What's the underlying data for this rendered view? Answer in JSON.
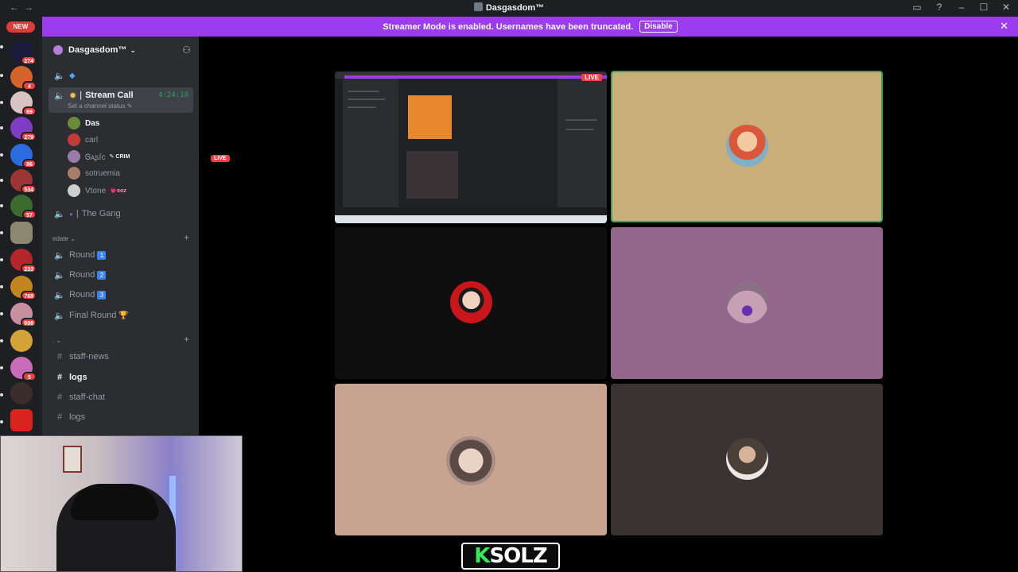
{
  "window": {
    "title": "Dasgasdom™"
  },
  "banner": {
    "message": "Streamer Mode is enabled. Usernames have been truncated.",
    "disable_label": "Disable"
  },
  "rail": {
    "new_label": "NEW",
    "servers": [
      {
        "badge": "274"
      },
      {
        "badge": "4"
      },
      {
        "badge": "69"
      },
      {
        "badge": "279"
      },
      {
        "badge": "86"
      },
      {
        "badge": "534"
      },
      {
        "badge": "57"
      },
      {
        "badge": ""
      },
      {
        "badge": "233"
      },
      {
        "badge": "768"
      },
      {
        "badge": "698"
      },
      {
        "badge": ""
      },
      {
        "badge": "5"
      },
      {
        "badge": ""
      },
      {
        "badge": ""
      }
    ]
  },
  "sidebar": {
    "server_name": "Dasgasdom™",
    "stream_call": {
      "name": "Stream Call",
      "timer": "4:24:18",
      "status_prompt": "Set a channel status"
    },
    "members": [
      {
        "name": "Das",
        "badge": "LIVE"
      },
      {
        "name": "carl",
        "tag": ""
      },
      {
        "name": "Ꮆᴀʂꭍᴄ",
        "tag": "CRIM"
      },
      {
        "name": "sotruemia",
        "tag": ""
      },
      {
        "name": "Vtone",
        "tag": "ooz"
      }
    ],
    "the_gang": "The Gang",
    "category_edate": "edate",
    "rounds": [
      {
        "label": "Round",
        "num": "1"
      },
      {
        "label": "Round",
        "num": "2"
      },
      {
        "label": "Round",
        "num": "3"
      },
      {
        "label": "Final Round",
        "num": "🏆"
      }
    ],
    "category_dot": ".",
    "text_channels": [
      "staff-news",
      "logs",
      "staff-chat",
      "logs"
    ]
  },
  "stream": {
    "live_label": "LIVE"
  },
  "brand": {
    "k": "K",
    "rest": "SOLZ"
  },
  "colors": {
    "accent": "#9b3cf0",
    "live": "#ed4245",
    "speaking": "#3ba55c"
  }
}
